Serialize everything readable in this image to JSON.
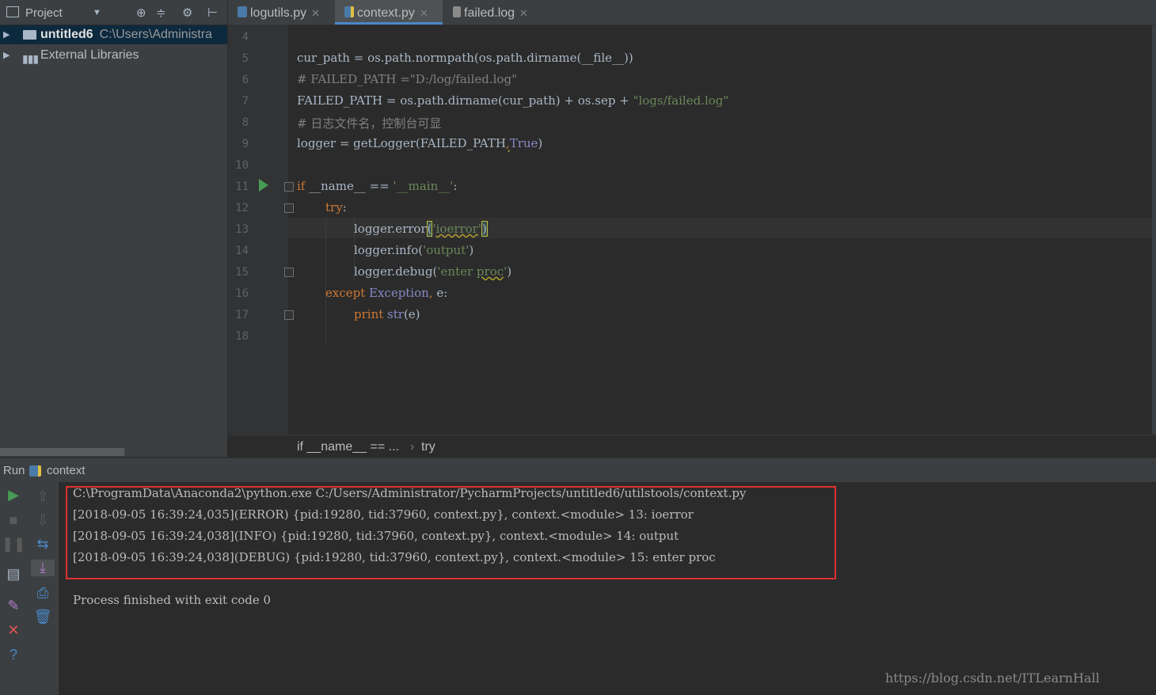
{
  "project_panel": {
    "title": "Project",
    "tree": [
      {
        "name": "untitled6",
        "path": "C:\\Users\\Administra"
      },
      {
        "name": "External Libraries"
      }
    ]
  },
  "tabs": [
    {
      "label": "logutils.py",
      "active": false
    },
    {
      "label": "context.py",
      "active": true
    },
    {
      "label": "failed.log",
      "active": false
    }
  ],
  "editor": {
    "line_numbers": [
      "4",
      "5",
      "6",
      "7",
      "8",
      "9",
      "10",
      "11",
      "12",
      "13",
      "14",
      "15",
      "16",
      "17",
      "18"
    ],
    "lines": {
      "l5": "cur_path = os.path.normpath(os.path.dirname(__file__))",
      "l6": "# FAILED_PATH =\"D:/log/failed.log\"",
      "l7a": "FAILED_PATH = os.path.dirname(cur_path) + os.sep + ",
      "l7b": "\"logs/failed.log\"",
      "l8": "# 日志文件名，控制台可显",
      "l9a": "logger = getLogger(FAILED_PATH",
      "l9b": ",",
      "l9c": "True",
      "l9d": ")",
      "l11a": "if",
      "l11b": " __name__ == ",
      "l11c": "'__main__'",
      "l11d": ":",
      "l12a": "try",
      "l12b": ":",
      "l13a": "logger.error",
      "l13b": "(",
      "l13c": "'",
      "l13d": "ioerror",
      "l13e": "'",
      "l13f": ")",
      "l14a": "logger.info(",
      "l14b": "'output'",
      "l14c": ")",
      "l15a": "logger.debug(",
      "l15b": "'enter ",
      "l15c": "proc",
      "l15d": "'",
      "l15e": ")",
      "l16a": "except",
      "l16b": " Exception",
      "l16c": ",",
      "l16d": " e:",
      "l17a": "print",
      "l17b": " str",
      "l17c": "(e)"
    }
  },
  "breadcrumb": [
    "if __name__ == ...",
    "try"
  ],
  "run": {
    "label": "Run",
    "config": "context",
    "output": [
      "C:\\ProgramData\\Anaconda2\\python.exe C:/Users/Administrator/PycharmProjects/untitled6/utilstools/context.py",
      "[2018-09-05 16:39:24,035](ERROR) {pid:19280, tid:37960, context.py}, context.<module> 13: ioerror",
      "[2018-09-05 16:39:24,038](INFO) {pid:19280, tid:37960, context.py}, context.<module> 14: output",
      "[2018-09-05 16:39:24,038](DEBUG) {pid:19280, tid:37960, context.py}, context.<module> 15: enter proc"
    ],
    "finished": "Process finished with exit code 0"
  },
  "watermark": "https://blog.csdn.net/ITLearnHall",
  "colors": {
    "keyword": "#cc7832",
    "string": "#6a8759",
    "comment": "#808080",
    "builtin": "#8888c6",
    "highlight_box": "#e03030"
  }
}
